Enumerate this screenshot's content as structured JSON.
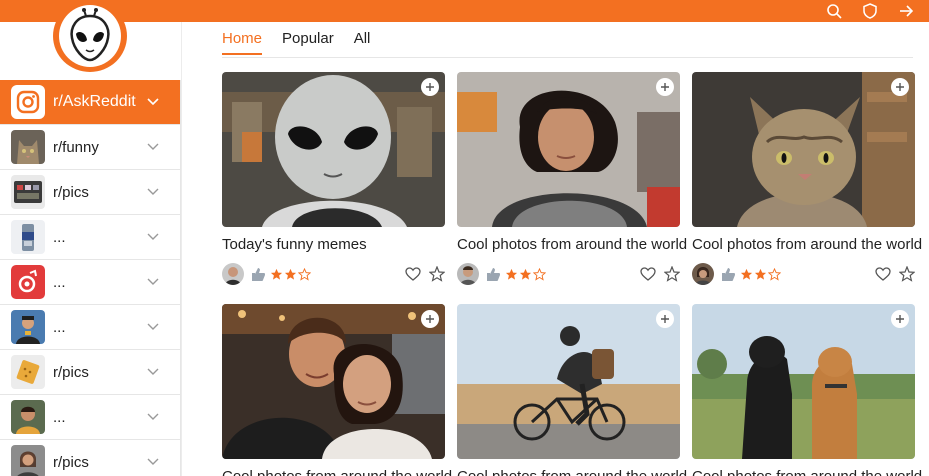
{
  "header": {
    "icons": [
      "search-icon",
      "shield-icon",
      "share-icon"
    ],
    "accent": "#f37021"
  },
  "logo": {
    "icon": "alien-icon"
  },
  "sidebar": {
    "items": [
      {
        "label": "r/AskReddit",
        "icon": "instagram-icon",
        "active": true
      },
      {
        "label": "r/funny",
        "icon": "cat-thumb"
      },
      {
        "label": "r/pics",
        "icon": "pics-thumb"
      },
      {
        "label": "...",
        "icon": "can-thumb"
      },
      {
        "label": "...",
        "icon": "red-app-thumb"
      },
      {
        "label": "...",
        "icon": "person-thumb"
      },
      {
        "label": "r/pics",
        "icon": "cracker-thumb"
      },
      {
        "label": "...",
        "icon": "portrait-thumb"
      },
      {
        "label": "r/pics",
        "icon": "portrait-thumb-2"
      }
    ]
  },
  "tabs": [
    {
      "label": "Home",
      "active": true
    },
    {
      "label": "Popular"
    },
    {
      "label": "All"
    }
  ],
  "cards": [
    {
      "title": "Today's funny memes",
      "rating": 3,
      "image": "alien-in-hoodie"
    },
    {
      "title": "Cool photos from around the world",
      "rating": 3,
      "image": "curly-hair-woman"
    },
    {
      "title": "Cool photos from around the world",
      "rating": 3,
      "image": "tabby-cat"
    },
    {
      "title": "Cool photos from around the world",
      "rating": 3,
      "image": "couple-selfie"
    },
    {
      "title": "Cool photos from around the world",
      "rating": 3,
      "image": "cyclist"
    },
    {
      "title": "Cool photos from around the world",
      "rating": 3,
      "image": "two-dogs"
    }
  ]
}
